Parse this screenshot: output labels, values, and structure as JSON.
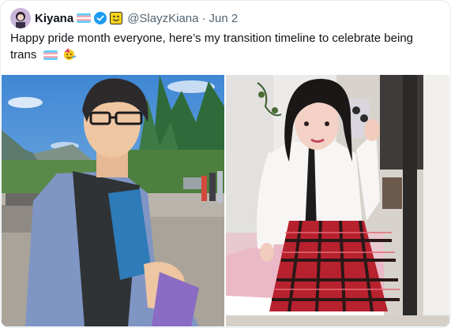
{
  "tweet": {
    "display_name": "Kiyana",
    "handle": "@SlayzKiana",
    "separator": "·",
    "date": "Jun 2",
    "text": "Happy pride month everyone, here’s my transition timeline to celebrate being trans",
    "icons": [
      "avatar",
      "trans-flag-emoji",
      "verified-badge-icon",
      "smiley-face-emoji",
      "partying-face-emoji"
    ],
    "colors": {
      "verified": "#1d9bf0",
      "handle": "#536471",
      "flag_blue": "#5bcefa",
      "flag_pink": "#f5a9b8"
    }
  },
  "media": {
    "images": [
      {
        "name": "before-photo",
        "content": "person in outdoor setting"
      },
      {
        "name": "after-photo",
        "content": "mirror selfie"
      }
    ]
  }
}
